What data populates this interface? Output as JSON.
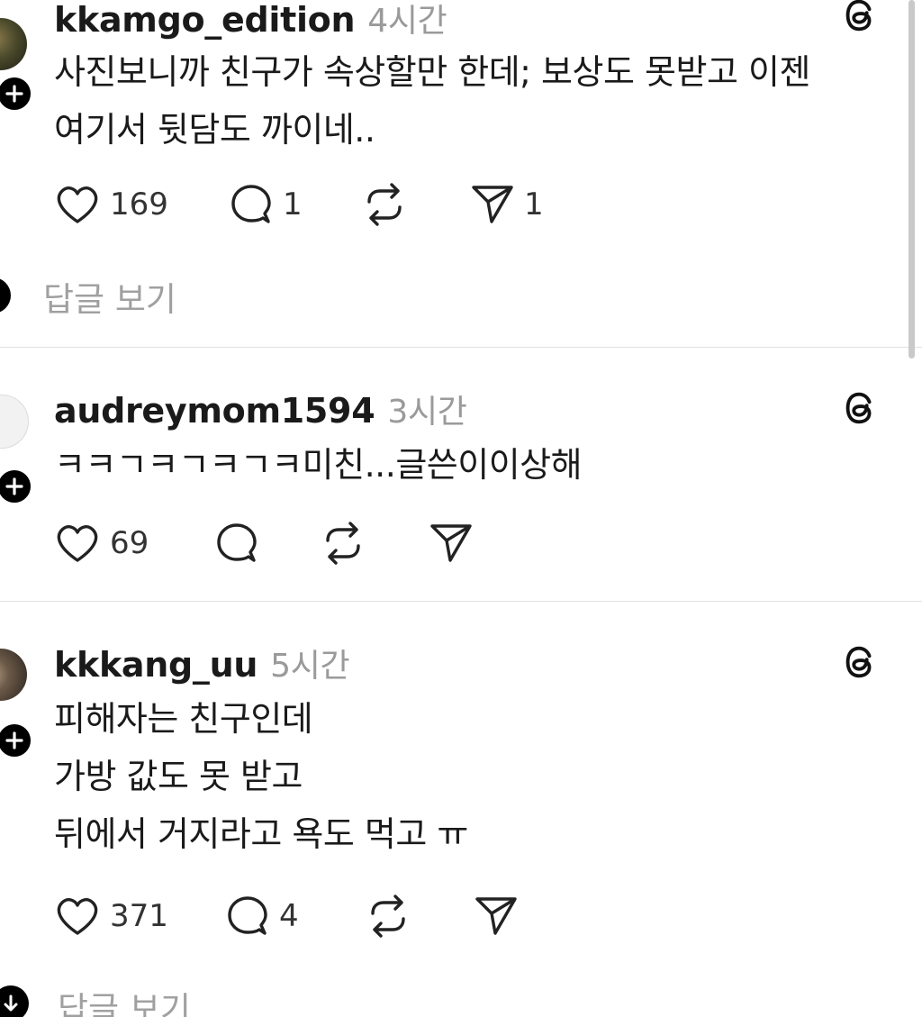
{
  "posts": [
    {
      "username": "kkamgo_edition",
      "time": "4시간",
      "lines": [
        "사진보니까 친구가 속상할만 한데; 보상도 못받고 이젠",
        "여기서 뒷담도 까이네.."
      ],
      "likes": "169",
      "comments": "1",
      "shares": "1",
      "view_replies": "답글 보기"
    },
    {
      "username": "audreymom1594",
      "time": "3시간",
      "lines": [
        "ㅋㅋㄱㅋㄱㅋㄱㅋ미친...글쓴이이상해"
      ],
      "likes": "69"
    },
    {
      "username": "kkkang_uu",
      "time": "5시간",
      "lines": [
        "피해자는 친구인데",
        "가방 값도 못 받고",
        "뒤에서 거지라고 욕도 먹고 ㅠ"
      ],
      "likes": "371",
      "comments": "4",
      "view_replies": "답글 보기"
    }
  ],
  "icons": {
    "like": "heart-icon",
    "comment": "comment-bubble-icon",
    "repost": "repost-icon",
    "share": "send-icon",
    "threads": "threads-logo-icon",
    "follow": "plus-icon"
  }
}
